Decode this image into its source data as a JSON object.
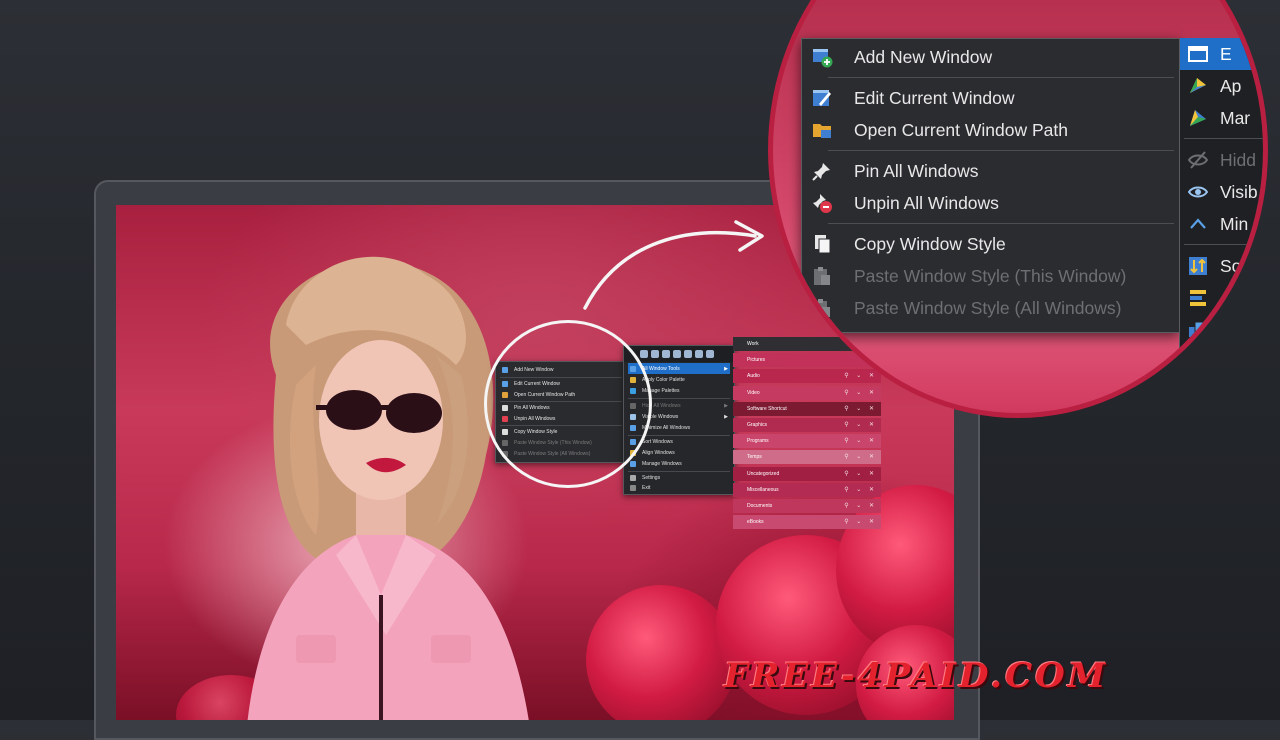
{
  "small_menu": {
    "items": [
      {
        "label": "Add New Window",
        "disabled": false
      },
      {
        "label": "Edit Current Window",
        "disabled": false
      },
      {
        "label": "Open Current Window Path",
        "disabled": false
      },
      {
        "label": "Pin All Windows",
        "disabled": false
      },
      {
        "label": "Unpin All Windows",
        "disabled": false
      },
      {
        "label": "Copy Window Style",
        "disabled": false
      },
      {
        "label": "Paste Window Style (This Window)",
        "disabled": true
      },
      {
        "label": "Paste Window Style (All Windows)",
        "disabled": true
      }
    ]
  },
  "tools_menu": {
    "items": [
      {
        "label": "All Window Tools",
        "selected": true,
        "submenu": true
      },
      {
        "label": "Apply Color Palette",
        "selected": false,
        "submenu": false
      },
      {
        "label": "Manage Palettes",
        "selected": false,
        "submenu": false
      },
      {
        "label": "Hide All Windows",
        "selected": false,
        "submenu": true
      },
      {
        "label": "Visible Windows",
        "selected": false,
        "submenu": true
      },
      {
        "label": "Minimize All Windows",
        "selected": false,
        "submenu": false
      },
      {
        "label": "Sort Windows",
        "selected": false,
        "submenu": false
      },
      {
        "label": "Align Windows",
        "selected": false,
        "submenu": false
      },
      {
        "label": "Manage Windows",
        "selected": false,
        "submenu": false
      },
      {
        "label": "Settings",
        "selected": false,
        "submenu": false
      },
      {
        "label": "Exit",
        "selected": false,
        "submenu": false
      }
    ]
  },
  "categories": [
    {
      "label": "Work",
      "color": "#2f2f33"
    },
    {
      "label": "Pictures",
      "color": "#c2315a"
    },
    {
      "label": "Audio",
      "color": "#b9274f"
    },
    {
      "label": "Video",
      "color": "#c43a61"
    },
    {
      "label": "Software Shortcut",
      "color": "#7c1a32"
    },
    {
      "label": "Graphics",
      "color": "#b02b4f"
    },
    {
      "label": "Programs",
      "color": "#c9456c"
    },
    {
      "label": "Temps",
      "color": "#cf6c89"
    },
    {
      "label": "Uncategorized",
      "color": "#a21f44"
    },
    {
      "label": "Miscellaneous",
      "color": "#b32b52"
    },
    {
      "label": "Documents",
      "color": "#c0375d"
    },
    {
      "label": "eBooks",
      "color": "#c84a70"
    }
  ],
  "zoom_menu": {
    "items": [
      {
        "label": "Add New Window",
        "icon": "add-window-icon",
        "disabled": false
      },
      {
        "label": "Edit Current Window",
        "icon": "edit-window-icon",
        "disabled": false
      },
      {
        "label": "Open Current Window Path",
        "icon": "folder-open-icon",
        "disabled": false
      },
      {
        "label": "Pin All Windows",
        "icon": "pin-icon",
        "disabled": false
      },
      {
        "label": "Unpin All Windows",
        "icon": "unpin-icon",
        "disabled": false
      },
      {
        "label": "Copy Window Style",
        "icon": "copy-style-icon",
        "disabled": false
      },
      {
        "label": "Paste Window Style (This Window)",
        "icon": "paste-style-icon",
        "disabled": true
      },
      {
        "label": "Paste Window Style (All Windows)",
        "icon": "paste-style-all-icon",
        "disabled": true
      }
    ]
  },
  "zoom_side": {
    "items": [
      {
        "label": "E",
        "icon": "window-icon",
        "selected": true,
        "disabled": false
      },
      {
        "label": "Ap",
        "icon": "palette-icon",
        "selected": false,
        "disabled": false
      },
      {
        "label": "Mar",
        "icon": "manage-palette-icon",
        "selected": false,
        "disabled": false
      },
      {
        "label": "Hidd",
        "icon": "hidden-eye-icon",
        "selected": false,
        "disabled": true
      },
      {
        "label": "Visib",
        "icon": "eye-icon",
        "selected": false,
        "disabled": false
      },
      {
        "label": "Min",
        "icon": "chevron-up-icon",
        "selected": false,
        "disabled": false
      },
      {
        "label": "So",
        "icon": "sort-icon",
        "selected": false,
        "disabled": false
      },
      {
        "label": "",
        "icon": "align-icon",
        "selected": false,
        "disabled": false
      },
      {
        "label": "",
        "icon": "cascade-icon",
        "selected": false,
        "disabled": false
      }
    ]
  },
  "watermark": "FREE-4PAID.COM",
  "colors": {
    "accent": "#1f6fc9",
    "brand_red": "#b91f40",
    "menu_bg": "#2b2c30"
  }
}
